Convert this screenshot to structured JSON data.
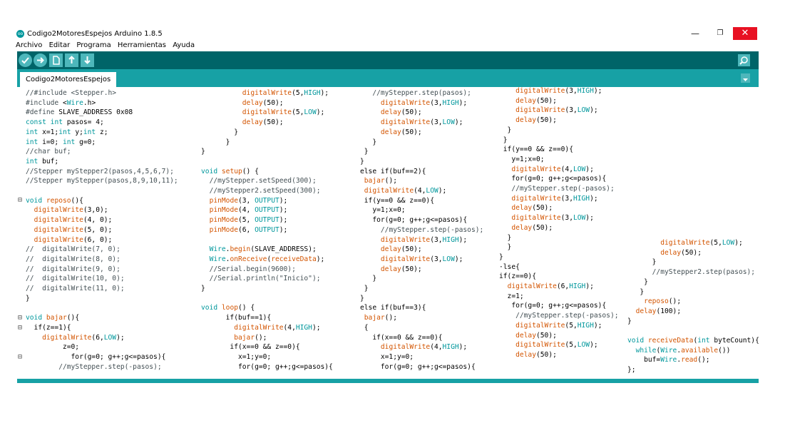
{
  "window": {
    "title": "Codigo2MotoresEspejos Arduino 1.8.5",
    "logo_text": "oo",
    "minimize": "—",
    "maximize": "❐",
    "close": "✕"
  },
  "menu": [
    "Archivo",
    "Editar",
    "Programa",
    "Herramientas",
    "Ayuda"
  ],
  "toolbar": {
    "buttons": [
      "verify-icon",
      "upload-icon",
      "new-icon",
      "open-icon",
      "save-icon"
    ],
    "serial_monitor": "magnifier-icon"
  },
  "tabs": [
    {
      "label": "Codigo2MotoresEspejos"
    }
  ],
  "colors": {
    "toolbar": "#006468",
    "tabbar": "#17a1a5",
    "close": "#e81123",
    "function": "#d35400",
    "keyword": "#00979c"
  },
  "code": {
    "col1": "//#include <Stepper.h>\n#include <Wire.h>\n#define SLAVE_ADDRESS 0x08\nconst int pasos= 4;\nint x=1;int y;int z;\nint i=0; int g=0;\n//char buf;\nint buf;\n//Stepper myStepper2(pasos,4,5,6,7);\n//Stepper myStepper(pasos,8,9,10,11);\n\nvoid reposo(){\n  digitalWrite(3,0);\n  digitalWrite(4, 0);\n  digitalWrite(5, 0);\n  digitalWrite(6, 0);\n//  digitalWrite(7, 0);\n//  digitalWrite(8, 0);\n//  digitalWrite(9, 0);\n//  digitalWrite(10, 0);\n//  digitalWrite(11, 0);\n}\n\nvoid bajar(){\n  if(z==1){\n    digitalWrite(6,LOW);\n         z=0;\n           for(g=0; g++;g<=pasos){\n        //myStepper.step(-pasos);",
    "col2": "          digitalWrite(5,HIGH);\n          delay(50);\n          digitalWrite(5,LOW);\n          delay(50);\n        }\n      }\n}\n\nvoid setup() {\n  //myStepper.setSpeed(300);\n  //myStepper2.setSpeed(300);\n  pinMode(3, OUTPUT);\n  pinMode(4, OUTPUT);\n  pinMode(5, OUTPUT);\n  pinMode(6, OUTPUT);\n\n  Wire.begin(SLAVE_ADDRESS);\n  Wire.onReceive(receiveData);\n  //Serial.begin(9600);\n  //Serial.println(\"Inicio\");\n}\n\nvoid loop() {\n      if(buf==1){\n        digitalWrite(4,HIGH);\n        bajar();\n       if(x==0 && z==0){\n         x=1;y=0;\n         for(g=0; g++;g<=pasos){",
    "col3": "   //myStepper.step(pasos);\n     digitalWrite(3,HIGH);\n     delay(50);\n     digitalWrite(3,LOW);\n     delay(50);\n   }\n }\n}\nelse if(buf==2){\n bajar();\n digitalWrite(4,LOW);\n if(y==0 && z==0){\n   y=1;x=0;\n   for(g=0; g++;g<=pasos){\n     //myStepper.step(-pasos);\n     digitalWrite(3,HIGH);\n     delay(50);\n     digitalWrite(3,LOW);\n     delay(50);\n   }\n }\n}\nelse if(buf==3){\n bajar();\n {\n   if(x==0 && z==0){\n     digitalWrite(4,HIGH);\n     x=1;y=0;\n     for(g=0; g++;g<=pasos){",
    "col4": "    digitalWrite(3,HIGH);\n    delay(50);\n    digitalWrite(3,LOW);\n    delay(50);\n  }\n }\n if(y==0 && z==0){\n   y=1;x=0;\n   digitalWrite(4,LOW);\n   for(g=0; g++;g<=pasos){\n   //myStepper.step(-pasos);\n   digitalWrite(3,HIGH);\n   delay(50);\n   digitalWrite(3,LOW);\n   delay(50);\n  }\n  }\n}\n·lse{\nif(z==0){\n  digitalWrite(6,HIGH);\n  z=1;\n   for(g=0; g++;g<=pasos){\n    //myStepper.step(-pasos);\n    digitalWrite(5,HIGH);\n    delay(50);\n    digitalWrite(5,LOW);\n    delay(50);",
    "col5": "        digitalWrite(5,LOW);\n        delay(50);\n      }\n      //myStepper2.step(pasos);\n    }\n   }\n    reposo();\n  delay(100);\n}\n\nvoid receiveData(int byteCount){\n  while(Wire.available())\n    buf=Wire.read();\n};"
  }
}
